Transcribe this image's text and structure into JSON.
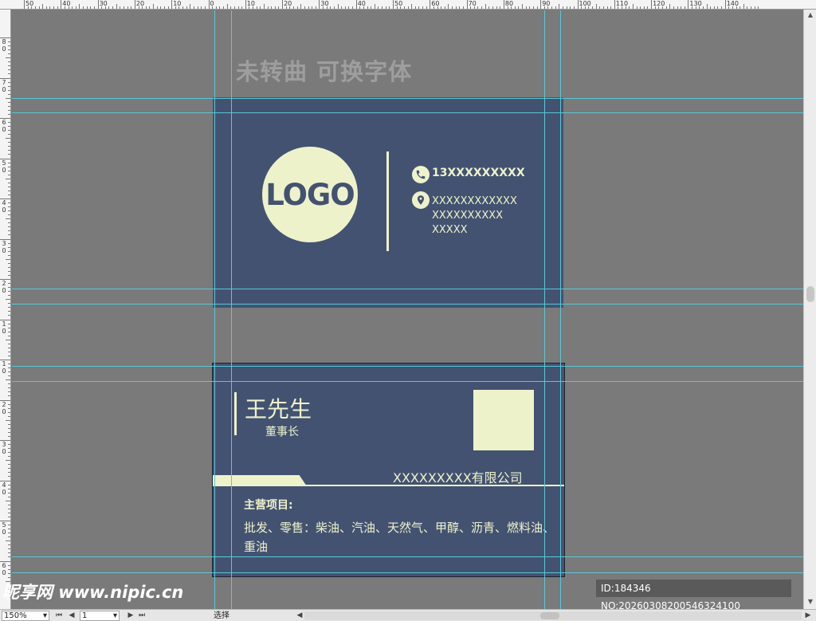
{
  "ruler": {
    "top_labels": [
      "50",
      "40",
      "30",
      "20",
      "10",
      "0",
      "10",
      "20",
      "30",
      "40",
      "50",
      "60",
      "70",
      "80",
      "90",
      "100",
      "110",
      "120",
      "130",
      "140"
    ],
    "left_labels": [
      "8 0",
      "7 0",
      "6 0",
      "5 0",
      "4 0",
      "3 0",
      "2 0",
      "1 0",
      "1 0",
      "2 0",
      "3 0",
      "4 0",
      "5 0",
      "6 0"
    ]
  },
  "heading": "未转曲  可换字体",
  "front": {
    "logo": "LOGO",
    "phone": "13XXXXXXXXX",
    "address_lines": [
      "XXXXXXXXXXXX",
      "XXXXXXXXXX",
      "XXXXX"
    ],
    "icons": {
      "phone": "phone-icon",
      "location": "location-pin-icon"
    }
  },
  "back": {
    "name": "王先生",
    "title": "董事长",
    "company": "XXXXXXXXX有限公司",
    "business_heading": "主营项目:",
    "business_body": "批发、零售：柴油、汽油、天然气、甲醇、沥青、燃料油、重油"
  },
  "colors": {
    "card_bg": "#435271",
    "accent": "#eef2cb",
    "guide": "#57c8d6",
    "workspace": "#7a7a7a"
  },
  "watermark": {
    "site": "昵享网 www.nipic.cn",
    "id": "ID:184346 NO:20260308200546324100"
  },
  "status": {
    "zoom": "150%",
    "page": "1",
    "tool": "选择"
  }
}
